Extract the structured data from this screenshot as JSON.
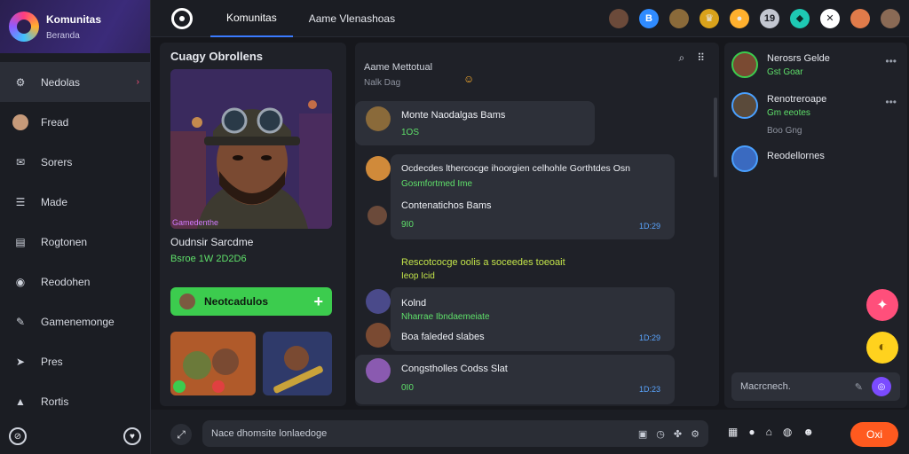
{
  "brand": {
    "title": "Komunitas",
    "subtitle": "Beranda"
  },
  "nav": {
    "items": [
      {
        "label": "Nedolas",
        "icon": "gear-icon"
      },
      {
        "label": "Fread",
        "icon": "avatar-icon"
      },
      {
        "label": "Sorers",
        "icon": "mail-icon"
      },
      {
        "label": "Made",
        "icon": "list-icon"
      },
      {
        "label": "Rogtonen",
        "icon": "chart-icon"
      },
      {
        "label": "Reodohen",
        "icon": "record-icon"
      },
      {
        "label": "Gamenemonge",
        "icon": "controller-icon"
      },
      {
        "label": "Pres",
        "icon": "send-icon"
      },
      {
        "label": "Rortis",
        "icon": "bell-icon"
      }
    ]
  },
  "topbar": {
    "tabs": [
      "Komunitas",
      "Aame Vlenashoas"
    ]
  },
  "profile": {
    "title": "Cuagy Obrollens",
    "tag": "Gamedenthe",
    "name": "Oudnsir Sarcdme",
    "stats": "Bsroe 1W 2D2D6",
    "follow_label": "Neotcadulos",
    "follow_plus": "+"
  },
  "chat": {
    "header": "Aame Mettotual",
    "subheader": "Nalk Dag",
    "messages": [
      {
        "title": "Monte Naodalgas Bams",
        "meta": "1OS",
        "time": ""
      },
      {
        "title": "Ocdecdes lthercocge ihoorgien celhohle Gorthtdes Osn",
        "meta": "Gosmfortmed Ime",
        "time": ""
      },
      {
        "title": "Contenatichos Bams",
        "meta": "9I0",
        "time": "1D:29"
      },
      {
        "title": "Rescotcocge oolis a soceedes toeoait",
        "meta": "Ieop Icid",
        "time": ""
      },
      {
        "title": "Kolnd",
        "meta": "Nharrae Ibndaemeiate",
        "time": ""
      },
      {
        "title": "Boa faleded slabes",
        "meta": "",
        "time": "1D:29"
      },
      {
        "title": "Congstholles Codss Slat",
        "meta": "0I0",
        "time": "1D:23"
      }
    ]
  },
  "friends": [
    {
      "name": "Nerosrs Gelde",
      "status": "Gst Goar"
    },
    {
      "name": "Renotreroape",
      "status": "Gm eeotes",
      "extra": "Boo Gng"
    },
    {
      "name": "Reodellornes",
      "status": ""
    }
  ],
  "side_input": {
    "placeholder": "Macrcnech."
  },
  "compose": {
    "placeholder": "Nace dhomsite lonlaedoge"
  },
  "send_label": "Oxi",
  "colors": {
    "accent": "#3a7bff",
    "green": "#3ccc4e",
    "orange": "#ff5a1f",
    "pink": "#ff4f7b"
  }
}
